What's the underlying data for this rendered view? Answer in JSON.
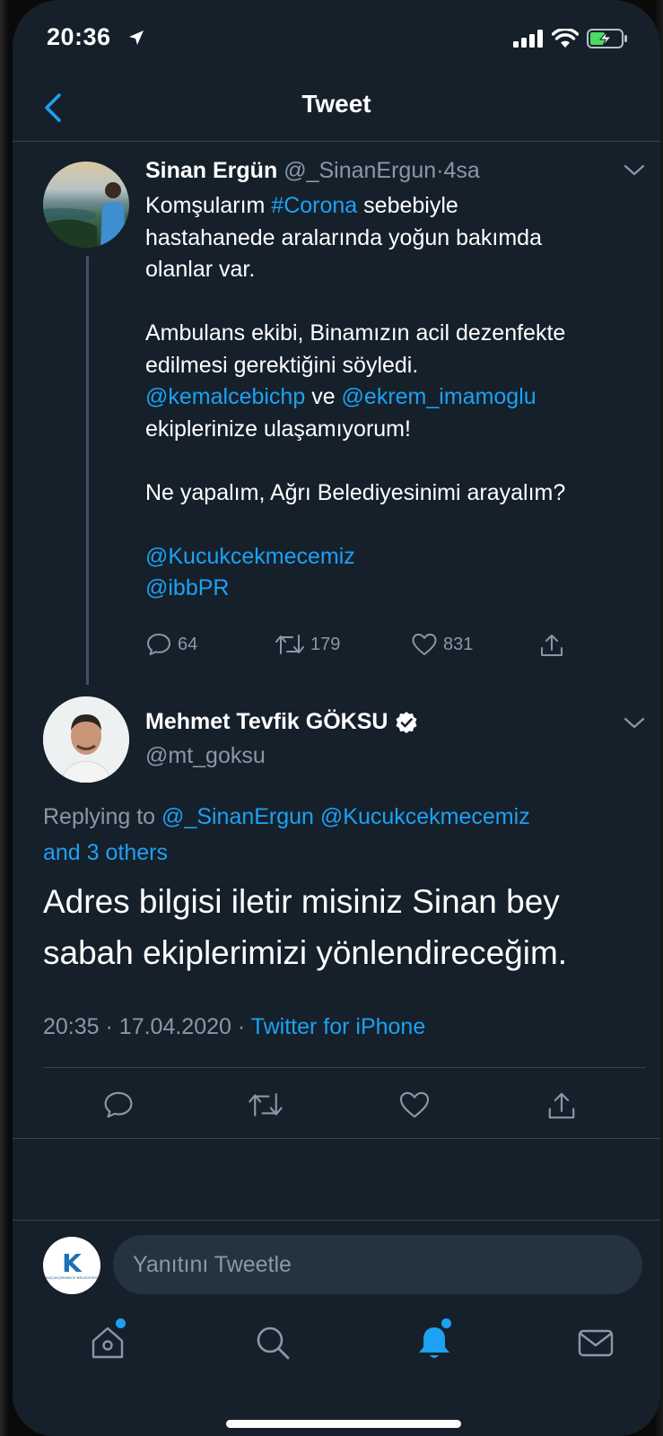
{
  "status_bar": {
    "time": "20:36"
  },
  "nav": {
    "title": "Tweet"
  },
  "parent_tweet": {
    "name": "Sinan Ergün",
    "handle": "@_SinanErgun",
    "separator": "·",
    "time": "4sa",
    "lines": [
      [
        {
          "t": "Komşularım "
        },
        {
          "t": "#Corona",
          "link": true
        },
        {
          "t": " sebebiyle"
        }
      ],
      [
        {
          "t": "hastahanede aralarında yoğun bakımda"
        }
      ],
      [
        {
          "t": "olanlar var."
        }
      ],
      [
        {
          "t": ""
        }
      ],
      [
        {
          "t": "Ambulans ekibi, Binamızın acil dezenfekte"
        }
      ],
      [
        {
          "t": "edilmesi gerektiğini söyledi."
        }
      ],
      [
        {
          "t": "@kemalcebichp",
          "link": true
        },
        {
          "t": " ve "
        },
        {
          "t": "@ekrem_imamoglu",
          "link": true
        }
      ],
      [
        {
          "t": "ekiplerinize ulaşamıyorum!"
        }
      ],
      [
        {
          "t": ""
        }
      ],
      [
        {
          "t": "Ne yapalım, Ağrı Belediyesinimi arayalım?"
        }
      ],
      [
        {
          "t": ""
        }
      ],
      [
        {
          "t": "@Kucukcekmecemiz",
          "link": true
        }
      ],
      [
        {
          "t": "@ibbPR",
          "link": true
        }
      ]
    ],
    "replies": "64",
    "retweets": "179",
    "likes": "831"
  },
  "main_tweet": {
    "name": "Mehmet Tevfik GÖKSU",
    "handle": "@mt_goksu",
    "replying_prefix": "Replying to",
    "replying_handles": "@_SinanErgun @Kucukcekmecemiz",
    "replying_others": "and 3 others",
    "text_line1": "Adres bilgisi iletir misiniz Sinan bey",
    "text_line2": "sabah ekiplerimizi yönlendireceğim.",
    "time": "20:35",
    "date": "17.04.2020",
    "dot": "·",
    "source": "Twitter for iPhone"
  },
  "reply_bar": {
    "placeholder": "Yanıtını Tweetle",
    "avatar_logo_letter": "K",
    "avatar_logo_text": "KÜÇÜKÇEKMECE BELEDİYESİ"
  },
  "colors": {
    "background": "#15202b",
    "link": "#1da1f2",
    "secondary_text": "#8899a6",
    "divider": "#38444d"
  },
  "tabs": [
    {
      "icon": "home-icon",
      "badge": true
    },
    {
      "icon": "search-icon",
      "badge": false
    },
    {
      "icon": "notifications-icon",
      "badge": true,
      "active": true
    },
    {
      "icon": "messages-icon",
      "badge": false
    }
  ]
}
